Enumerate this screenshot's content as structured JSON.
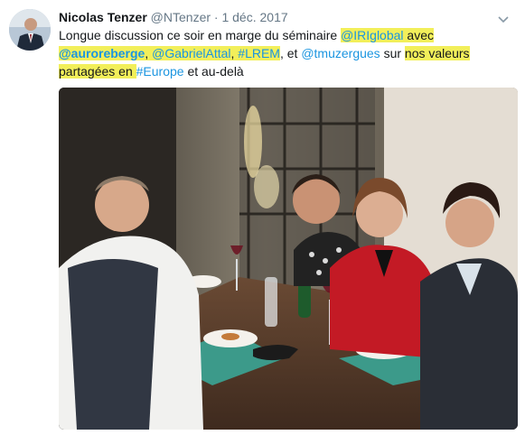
{
  "tweet": {
    "author_name": "Nicolas Tenzer",
    "handle": "@NTenzer",
    "separator": "·",
    "date": "1 déc. 2017",
    "text": {
      "l1_a": "Longue discussion ce soir en marge du séminaire ",
      "l1_mention": "@IRIglobal",
      "l1_b": " avec",
      "l2_mention1": "@auroreberge",
      "l2_comma1": ", ",
      "l2_mention2": "@GabrielAttal",
      "l2_comma2": ", ",
      "l2_hashtag": "#LREM",
      "l2_b": ", et ",
      "l2_mention3": "@tmuzergues",
      "l2_c": " sur ",
      "l2_hl": "nos valeurs",
      "l3_hl": "partagées en ",
      "l3_hashtag": "#Europe",
      "l3_b": " et au-delà"
    }
  },
  "colors": {
    "link": "#1b95e0",
    "highlight": "#f2ef5a",
    "muted": "#657786"
  },
  "icons": {
    "menu": "chevron-down-icon",
    "avatar": "avatar"
  }
}
